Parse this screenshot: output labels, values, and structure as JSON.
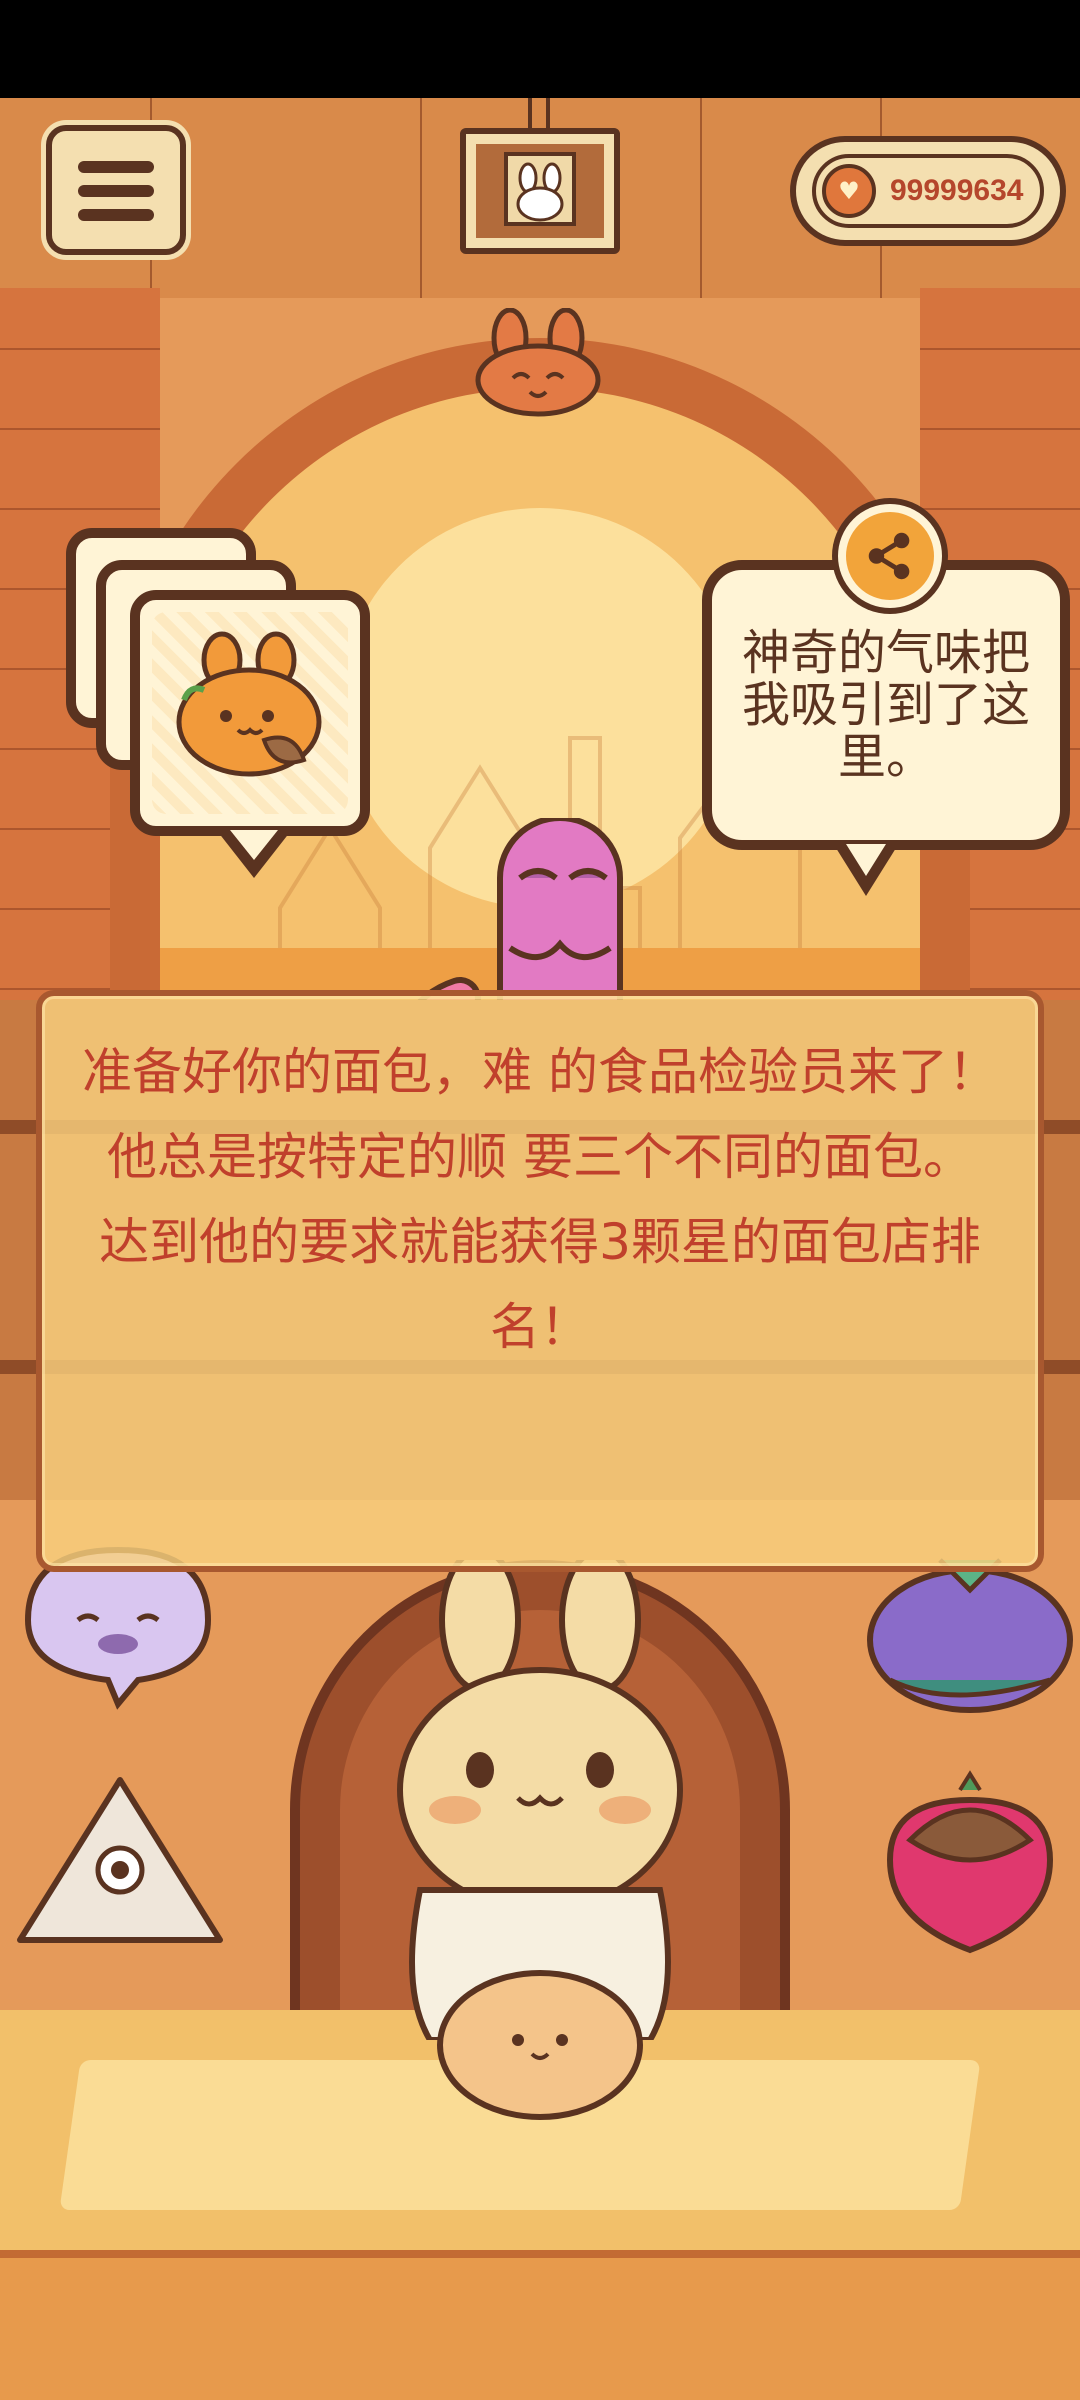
{
  "hud": {
    "currency_value": "99999634",
    "currency_icon": "heart-coin-icon",
    "menu_icon": "hamburger-menu-icon",
    "share_icon": "share-icon"
  },
  "customer": {
    "speech": "神奇的气味把我吸引到了这里。"
  },
  "tutorial": {
    "lines": [
      "准备好你的面包，难 的食品检验员来了！",
      "他总是按特定的顺 要三个不同的面包。",
      "达到他的要求就能获得3颗星的面包店排名！"
    ]
  },
  "colors": {
    "outline": "#5a3320",
    "panel": "#fff4d6",
    "tutorial_text": "#c0402c",
    "currency_text": "#b5462c",
    "share_button": "#f2a43a"
  }
}
